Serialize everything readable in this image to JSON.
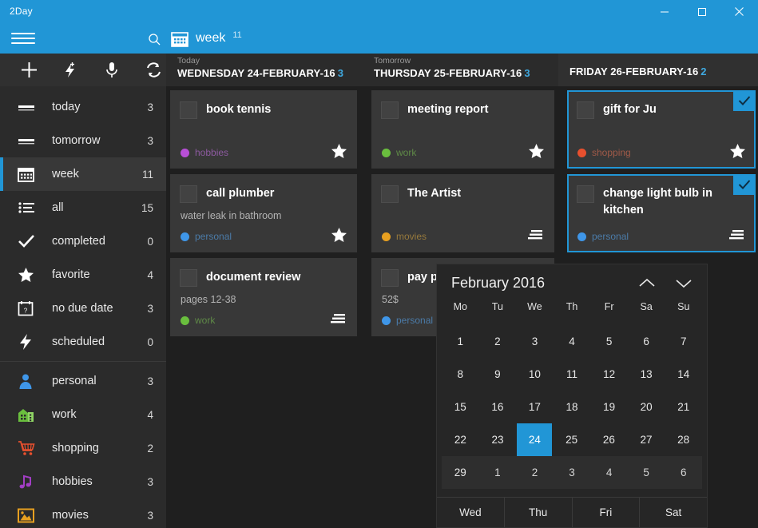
{
  "window": {
    "app_title": "2Day",
    "buttons": [
      {
        "name": "minimize",
        "glyph": "—"
      },
      {
        "name": "maximize",
        "glyph": "□"
      },
      {
        "name": "close",
        "glyph": "✕"
      }
    ]
  },
  "commandbar": {
    "menu_icon": "hamburger-icon",
    "search_icon": "search-icon",
    "view_icon": "calendar-icon",
    "view_label": "week",
    "view_count": "11"
  },
  "sidebar": {
    "toolbar": [
      {
        "name": "add-task-button",
        "icon": "plus-icon"
      },
      {
        "name": "quick-add-button",
        "icon": "lightning-plus-icon"
      },
      {
        "name": "voice-input-button",
        "icon": "microphone-icon"
      },
      {
        "name": "sync-button",
        "icon": "sync-icon"
      }
    ],
    "items": [
      {
        "label": "today",
        "count": "3",
        "icon": "today-icon",
        "active": false
      },
      {
        "label": "tomorrow",
        "count": "3",
        "icon": "tomorrow-icon",
        "active": false
      },
      {
        "label": "week",
        "count": "11",
        "icon": "calendar-icon",
        "active": true
      },
      {
        "label": "all",
        "count": "15",
        "icon": "list-icon",
        "active": false
      },
      {
        "label": "completed",
        "count": "0",
        "icon": "check-icon",
        "active": false
      },
      {
        "label": "favorite",
        "count": "4",
        "icon": "star-icon",
        "active": false
      },
      {
        "label": "no due date",
        "count": "3",
        "icon": "calendar-question-icon",
        "active": false
      },
      {
        "label": "scheduled",
        "count": "0",
        "icon": "lightning-icon",
        "active": false
      }
    ],
    "groups": [
      {
        "label": "personal",
        "count": "3",
        "icon": "person-icon",
        "color": "#3f96e8"
      },
      {
        "label": "work",
        "count": "4",
        "icon": "building-icon",
        "color": "#6abf3e"
      },
      {
        "label": "shopping",
        "count": "2",
        "icon": "cart-icon",
        "color": "#e8502e"
      },
      {
        "label": "hobbies",
        "count": "3",
        "icon": "music-icon",
        "color": "#a23ec4"
      },
      {
        "label": "movies",
        "count": "3",
        "icon": "photo-icon",
        "color": "#e8a020"
      }
    ]
  },
  "board": {
    "columns": [
      {
        "relative": "Today",
        "day": "WEDNESDAY 24-FEBRUARY-16",
        "count": "3",
        "selected": false,
        "cards": [
          {
            "title": "book tennis",
            "note": "",
            "category": "hobbies",
            "color": "#b84fd6",
            "mark": "star-icon",
            "checked": false
          },
          {
            "title": "call plumber",
            "note": "water leak in bathroom",
            "category": "personal",
            "color": "#3f96e8",
            "mark": "star-icon",
            "checked": false
          },
          {
            "title": "document review",
            "note": "pages 12-38",
            "category": "work",
            "color": "#6abf3e",
            "mark": "notes-icon",
            "checked": false
          }
        ]
      },
      {
        "relative": "Tomorrow",
        "day": "THURSDAY 25-FEBRUARY-16",
        "count": "3",
        "selected": false,
        "cards": [
          {
            "title": "meeting report",
            "note": "",
            "category": "work",
            "color": "#6abf3e",
            "mark": "star-icon",
            "checked": false
          },
          {
            "title": "The Artist",
            "note": "",
            "category": "movies",
            "color": "#e8a020",
            "mark": "notes-icon",
            "checked": false
          },
          {
            "title": "pay phone bill",
            "note": "52$",
            "category": "personal",
            "color": "#3f96e8",
            "mark": "notes-icon",
            "checked": false
          }
        ]
      },
      {
        "relative": "",
        "day": "FRIDAY 26-FEBRUARY-16",
        "count": "2",
        "selected": true,
        "cards": [
          {
            "title": "gift for Ju",
            "note": "",
            "category": "shopping",
            "color": "#e8502e",
            "mark": "star-icon",
            "checked": true
          },
          {
            "title": "change light bulb in kitchen",
            "note": "",
            "category": "personal",
            "color": "#3f96e8",
            "mark": "notes-icon",
            "checked": true
          }
        ]
      }
    ]
  },
  "calendar": {
    "title": "February 2016",
    "prev_icon": "chevron-up-icon",
    "next_icon": "chevron-down-icon",
    "weekdays": [
      "Mo",
      "Tu",
      "We",
      "Th",
      "Fr",
      "Sa",
      "Su"
    ],
    "weeks": [
      [
        {
          "d": "1"
        },
        {
          "d": "2"
        },
        {
          "d": "3"
        },
        {
          "d": "4"
        },
        {
          "d": "5"
        },
        {
          "d": "6"
        },
        {
          "d": "7"
        }
      ],
      [
        {
          "d": "8"
        },
        {
          "d": "9"
        },
        {
          "d": "10"
        },
        {
          "d": "11"
        },
        {
          "d": "12"
        },
        {
          "d": "13"
        },
        {
          "d": "14"
        }
      ],
      [
        {
          "d": "15"
        },
        {
          "d": "16"
        },
        {
          "d": "17"
        },
        {
          "d": "18"
        },
        {
          "d": "19"
        },
        {
          "d": "20"
        },
        {
          "d": "21"
        }
      ],
      [
        {
          "d": "22"
        },
        {
          "d": "23"
        },
        {
          "d": "24",
          "today": true
        },
        {
          "d": "25"
        },
        {
          "d": "26"
        },
        {
          "d": "27"
        },
        {
          "d": "28"
        }
      ],
      [
        {
          "d": "29"
        },
        {
          "d": "1",
          "other": true
        },
        {
          "d": "2",
          "other": true
        },
        {
          "d": "3",
          "other": true
        },
        {
          "d": "4",
          "other": true
        },
        {
          "d": "5",
          "other": true
        },
        {
          "d": "6",
          "other": true
        }
      ]
    ],
    "footer": [
      "Wed",
      "Thu",
      "Fri",
      "Sat"
    ]
  },
  "colors": {
    "accent": "#2196d6",
    "window_bg": "#1f1f1f",
    "sidebar_bg": "#2b2b2b",
    "card_bg": "#383838"
  }
}
